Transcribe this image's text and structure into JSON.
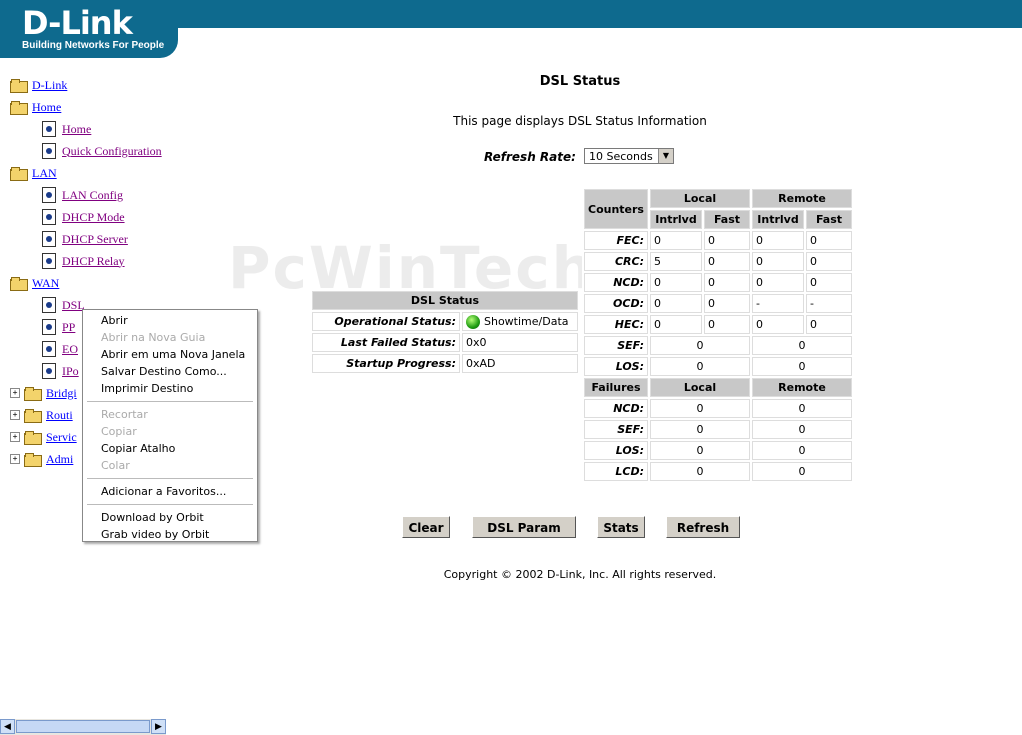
{
  "brand": {
    "name": "D-Link",
    "tagline": "Building Networks For People"
  },
  "nav": {
    "root": "D-Link",
    "items": [
      {
        "label": "Home",
        "level": 1,
        "type": "folder",
        "y": 0
      },
      {
        "label": "Home",
        "level": 2,
        "type": "doc"
      },
      {
        "label": "Quick Configuration",
        "level": 2,
        "type": "doc"
      },
      {
        "label": "LAN",
        "level": 1,
        "type": "folder"
      },
      {
        "label": "LAN Config",
        "level": 2,
        "type": "doc"
      },
      {
        "label": "DHCP Mode",
        "level": 2,
        "type": "doc"
      },
      {
        "label": "DHCP Server",
        "level": 2,
        "type": "doc"
      },
      {
        "label": "DHCP Relay",
        "level": 2,
        "type": "doc"
      },
      {
        "label": "WAN",
        "level": 1,
        "type": "folder"
      },
      {
        "label": "DSL",
        "level": 2,
        "type": "doc"
      },
      {
        "label": "PP",
        "level": 2,
        "type": "doc"
      },
      {
        "label": "EO",
        "level": 2,
        "type": "doc"
      },
      {
        "label": "IPo",
        "level": 2,
        "type": "doc"
      },
      {
        "label": "Bridgi",
        "level": 1,
        "type": "folder-collapsed"
      },
      {
        "label": "Routi",
        "level": 1,
        "type": "folder-collapsed"
      },
      {
        "label": "Servic",
        "level": 1,
        "type": "folder-collapsed"
      },
      {
        "label": "Admi",
        "level": 1,
        "type": "folder-collapsed"
      }
    ]
  },
  "context_menu": {
    "items": [
      {
        "label": "Abrir",
        "disabled": false
      },
      {
        "label": "Abrir na Nova Guia",
        "disabled": true
      },
      {
        "label": "Abrir em uma Nova Janela",
        "disabled": false
      },
      {
        "label": "Salvar Destino Como...",
        "disabled": false
      },
      {
        "label": "Imprimir Destino",
        "disabled": false
      },
      {
        "label": "Recortar",
        "disabled": true
      },
      {
        "label": "Copiar",
        "disabled": true
      },
      {
        "label": "Copiar Atalho",
        "disabled": false
      },
      {
        "label": "Colar",
        "disabled": true
      },
      {
        "label": "Adicionar a Favoritos...",
        "disabled": false
      },
      {
        "label": "Download by Orbit",
        "disabled": false
      },
      {
        "label": "Grab video by Orbit",
        "disabled": false
      }
    ]
  },
  "main": {
    "title": "DSL Status",
    "description": "This page displays DSL Status Information",
    "refresh_label": "Refresh Rate:",
    "refresh_value": "10 Seconds",
    "watermark": "PcWinTech.com",
    "copyright": "Copyright © 2002 D-Link, Inc. All rights reserved."
  },
  "dsl_status": {
    "header": "DSL Status",
    "rows": [
      {
        "label": "Operational Status:",
        "value": "Showtime/Data"
      },
      {
        "label": "Last Failed Status:",
        "value": "0x0"
      },
      {
        "label": "Startup Progress:",
        "value": "0xAD"
      }
    ]
  },
  "counters": {
    "h_counters": "Counters",
    "h_local": "Local",
    "h_remote": "Remote",
    "h_intrlvd": "Intrlvd",
    "h_fast": "Fast",
    "rows4": [
      {
        "label": "FEC:",
        "v": [
          "0",
          "0",
          "0",
          "0"
        ]
      },
      {
        "label": "CRC:",
        "v": [
          "5",
          "0",
          "0",
          "0"
        ]
      },
      {
        "label": "NCD:",
        "v": [
          "0",
          "0",
          "0",
          "0"
        ]
      },
      {
        "label": "OCD:",
        "v": [
          "0",
          "0",
          "-",
          "-"
        ]
      },
      {
        "label": "HEC:",
        "v": [
          "0",
          "0",
          "0",
          "0"
        ]
      }
    ],
    "rows2": [
      {
        "label": "SEF:",
        "v": [
          "0",
          "0"
        ]
      },
      {
        "label": "LOS:",
        "v": [
          "0",
          "0"
        ]
      }
    ],
    "h_failures": "Failures",
    "frows": [
      {
        "label": "NCD:",
        "v": [
          "0",
          "0"
        ]
      },
      {
        "label": "SEF:",
        "v": [
          "0",
          "0"
        ]
      },
      {
        "label": "LOS:",
        "v": [
          "0",
          "0"
        ]
      },
      {
        "label": "LCD:",
        "v": [
          "0",
          "0"
        ]
      }
    ]
  },
  "buttons": {
    "clear": "Clear",
    "dsl_param": "DSL Param",
    "stats": "Stats",
    "refresh": "Refresh"
  }
}
